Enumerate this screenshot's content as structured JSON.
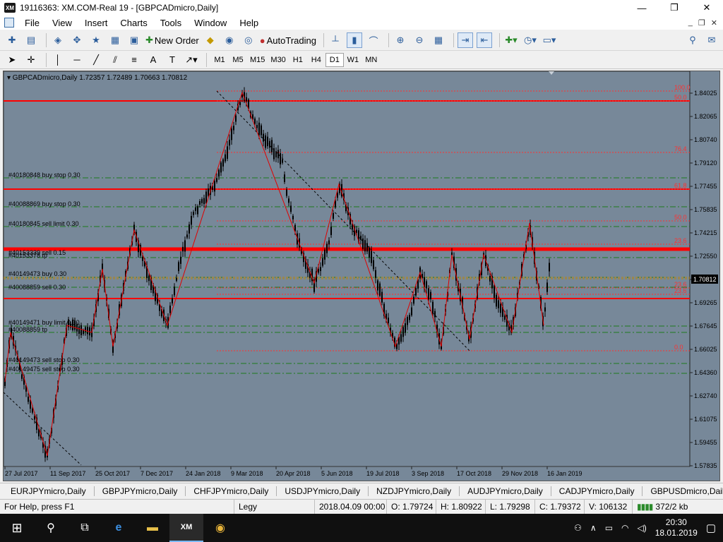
{
  "window": {
    "title": "19116363: XM.COM-Real 19 - [GBPCADmicro,Daily]",
    "logo": "XM",
    "minimize": "—",
    "maximize": "❐",
    "close": "✕"
  },
  "menu": {
    "items": [
      "File",
      "View",
      "Insert",
      "Charts",
      "Tools",
      "Window",
      "Help"
    ],
    "mdi_controls": [
      "_",
      "❐",
      "✕"
    ]
  },
  "toolbar": {
    "new_order": "New Order",
    "autotrading": "AutoTrading"
  },
  "timeframes": {
    "items": [
      "M1",
      "M5",
      "M15",
      "M30",
      "H1",
      "H4",
      "D1",
      "W1",
      "MN"
    ],
    "active": "D1"
  },
  "chart": {
    "header": "GBPCADmicro,Daily  1.72357 1.72489 1.70663 1.70812",
    "current_price": "1.70812",
    "colors": {
      "background": "#778899",
      "candles": "#000000",
      "support_resistance": "#ff0000",
      "fibo": "#ff3030",
      "orders": "#008000"
    },
    "price_axis": [
      "1.84025",
      "1.82065",
      "1.80740",
      "1.79120",
      "1.77455",
      "1.75835",
      "1.74215",
      "1.72550",
      "1.70812",
      "1.69265",
      "1.67645",
      "1.66025",
      "1.64360",
      "1.62740",
      "1.61075",
      "1.59455",
      "1.57835"
    ],
    "date_axis": [
      "27 Jul 2017",
      "11 Sep 2017",
      "25 Oct 2017",
      "7 Dec 2017",
      "24 Jan 2018",
      "9 Mar 2018",
      "20 Apr 2018",
      "5 Jun 2018",
      "19 Jul 2018",
      "3 Sep 2018",
      "17 Oct 2018",
      "29 Nov 2018",
      "16 Jan 2019"
    ],
    "fibo_levels": [
      "100.0",
      "50.0",
      "76.4",
      "61.8",
      "50.0",
      "23.6",
      "23.6",
      "23.6",
      "0.0"
    ],
    "orders": [
      "#40180848 buy stop 0.30",
      "#40088869 buy stop 0.30",
      "#40180845 sell limit 0.30",
      "#40153339 sell 0.15",
      "#40153378 tp",
      "#40149473 buy 0.30",
      "#40088859 sell 0.30",
      "#40149471 buy limit 0.30",
      "#40088859 tp",
      "#40149473 sell stop 0.30",
      "#40149475 sell stop 0.30"
    ]
  },
  "symbol_tabs": {
    "items": [
      "EURJPYmicro,Daily",
      "GBPJPYmicro,Daily",
      "CHFJPYmicro,Daily",
      "USDJPYmicro,Daily",
      "NZDJPYmicro,Daily",
      "AUDJPYmicro,Daily",
      "CADJPYmicro,Daily",
      "GBPUSDmicro,Daily"
    ],
    "active": "GBPCADmicro,Daily"
  },
  "status": {
    "help": "For Help, press F1",
    "profile": "Legy",
    "datetime": "2018.04.09 00:00",
    "open": "O: 1.79724",
    "high": "H: 1.80922",
    "low": "L: 1.79298",
    "close": "C: 1.79372",
    "volume": "V: 106132",
    "traffic": "372/2 kb"
  },
  "taskbar": {
    "time": "20:30",
    "date": "18.01.2019"
  }
}
